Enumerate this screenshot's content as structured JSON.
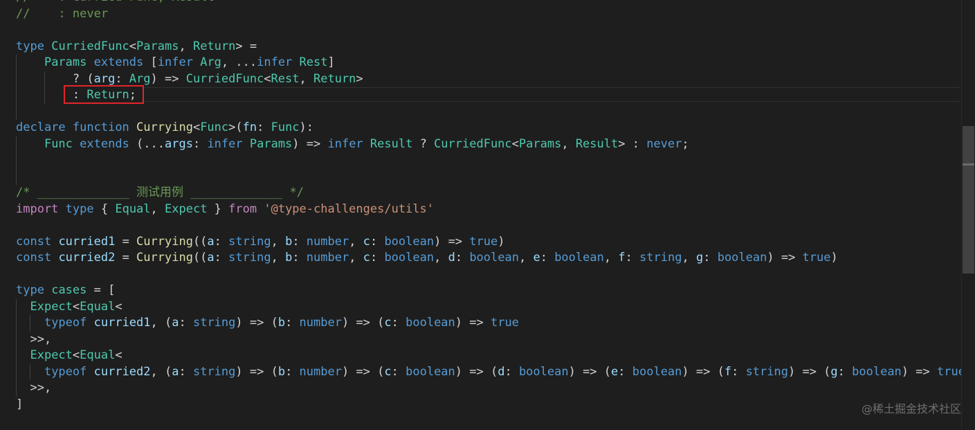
{
  "lines": [
    [
      {
        "t": "//    : Curried<Func, Result>",
        "c": "comment"
      }
    ],
    [
      {
        "t": "//    : never",
        "c": "comment"
      }
    ],
    [],
    [
      {
        "t": "type",
        "c": "keyword"
      },
      {
        "t": " ",
        "c": "plain"
      },
      {
        "t": "CurriedFunc",
        "c": "type"
      },
      {
        "t": "<",
        "c": "punct"
      },
      {
        "t": "Params",
        "c": "type"
      },
      {
        "t": ", ",
        "c": "punct"
      },
      {
        "t": "Return",
        "c": "type"
      },
      {
        "t": "> =",
        "c": "punct"
      }
    ],
    [
      {
        "t": "    ",
        "c": "plain"
      },
      {
        "t": "Params",
        "c": "type"
      },
      {
        "t": " ",
        "c": "plain"
      },
      {
        "t": "extends",
        "c": "keyword"
      },
      {
        "t": " [",
        "c": "punct"
      },
      {
        "t": "infer",
        "c": "keyword"
      },
      {
        "t": " ",
        "c": "plain"
      },
      {
        "t": "Arg",
        "c": "type"
      },
      {
        "t": ", ...",
        "c": "punct"
      },
      {
        "t": "infer",
        "c": "keyword"
      },
      {
        "t": " ",
        "c": "plain"
      },
      {
        "t": "Rest",
        "c": "type"
      },
      {
        "t": "]",
        "c": "punct"
      }
    ],
    [
      {
        "t": "        ? (",
        "c": "punct"
      },
      {
        "t": "arg",
        "c": "var"
      },
      {
        "t": ": ",
        "c": "punct"
      },
      {
        "t": "Arg",
        "c": "type"
      },
      {
        "t": ") => ",
        "c": "punct"
      },
      {
        "t": "CurriedFunc",
        "c": "type"
      },
      {
        "t": "<",
        "c": "punct"
      },
      {
        "t": "Rest",
        "c": "type"
      },
      {
        "t": ", ",
        "c": "punct"
      },
      {
        "t": "Return",
        "c": "type"
      },
      {
        "t": ">",
        "c": "punct"
      }
    ],
    [
      {
        "t": "        : ",
        "c": "punct"
      },
      {
        "t": "Return",
        "c": "type"
      },
      {
        "t": ";",
        "c": "punct"
      }
    ],
    [],
    [
      {
        "t": "declare",
        "c": "keyword"
      },
      {
        "t": " ",
        "c": "plain"
      },
      {
        "t": "function",
        "c": "keyword"
      },
      {
        "t": " ",
        "c": "plain"
      },
      {
        "t": "Currying",
        "c": "func"
      },
      {
        "t": "<",
        "c": "punct"
      },
      {
        "t": "Func",
        "c": "type"
      },
      {
        "t": ">(",
        "c": "punct"
      },
      {
        "t": "fn",
        "c": "var"
      },
      {
        "t": ": ",
        "c": "punct"
      },
      {
        "t": "Func",
        "c": "type"
      },
      {
        "t": "):",
        "c": "punct"
      }
    ],
    [
      {
        "t": "    ",
        "c": "plain"
      },
      {
        "t": "Func",
        "c": "type"
      },
      {
        "t": " ",
        "c": "plain"
      },
      {
        "t": "extends",
        "c": "keyword"
      },
      {
        "t": " (...",
        "c": "punct"
      },
      {
        "t": "args",
        "c": "var"
      },
      {
        "t": ": ",
        "c": "punct"
      },
      {
        "t": "infer",
        "c": "keyword"
      },
      {
        "t": " ",
        "c": "plain"
      },
      {
        "t": "Params",
        "c": "type"
      },
      {
        "t": ") => ",
        "c": "punct"
      },
      {
        "t": "infer",
        "c": "keyword"
      },
      {
        "t": " ",
        "c": "plain"
      },
      {
        "t": "Result",
        "c": "type"
      },
      {
        "t": " ? ",
        "c": "punct"
      },
      {
        "t": "CurriedFunc",
        "c": "type"
      },
      {
        "t": "<",
        "c": "punct"
      },
      {
        "t": "Params",
        "c": "type"
      },
      {
        "t": ", ",
        "c": "punct"
      },
      {
        "t": "Result",
        "c": "type"
      },
      {
        "t": "> : ",
        "c": "punct"
      },
      {
        "t": "never",
        "c": "keyword"
      },
      {
        "t": ";",
        "c": "punct"
      }
    ],
    [],
    [],
    [
      {
        "t": "/* _____________ 测试用例 _____________ */",
        "c": "comment"
      }
    ],
    [
      {
        "t": "import",
        "c": "control"
      },
      {
        "t": " ",
        "c": "plain"
      },
      {
        "t": "type",
        "c": "keyword"
      },
      {
        "t": " { ",
        "c": "punct"
      },
      {
        "t": "Equal",
        "c": "type"
      },
      {
        "t": ", ",
        "c": "punct"
      },
      {
        "t": "Expect",
        "c": "type"
      },
      {
        "t": " } ",
        "c": "punct"
      },
      {
        "t": "from",
        "c": "control"
      },
      {
        "t": " ",
        "c": "plain"
      },
      {
        "t": "'@type-challenges/utils'",
        "c": "string"
      }
    ],
    [],
    [
      {
        "t": "const",
        "c": "keyword"
      },
      {
        "t": " ",
        "c": "plain"
      },
      {
        "t": "curried1",
        "c": "var"
      },
      {
        "t": " = ",
        "c": "punct"
      },
      {
        "t": "Currying",
        "c": "func"
      },
      {
        "t": "((",
        "c": "punct"
      },
      {
        "t": "a",
        "c": "var"
      },
      {
        "t": ": ",
        "c": "punct"
      },
      {
        "t": "string",
        "c": "keyword"
      },
      {
        "t": ", ",
        "c": "punct"
      },
      {
        "t": "b",
        "c": "var"
      },
      {
        "t": ": ",
        "c": "punct"
      },
      {
        "t": "number",
        "c": "keyword"
      },
      {
        "t": ", ",
        "c": "punct"
      },
      {
        "t": "c",
        "c": "var"
      },
      {
        "t": ": ",
        "c": "punct"
      },
      {
        "t": "boolean",
        "c": "keyword"
      },
      {
        "t": ") => ",
        "c": "punct"
      },
      {
        "t": "true",
        "c": "keyword"
      },
      {
        "t": ")",
        "c": "punct"
      }
    ],
    [
      {
        "t": "const",
        "c": "keyword"
      },
      {
        "t": " ",
        "c": "plain"
      },
      {
        "t": "curried2",
        "c": "var"
      },
      {
        "t": " = ",
        "c": "punct"
      },
      {
        "t": "Currying",
        "c": "func"
      },
      {
        "t": "((",
        "c": "punct"
      },
      {
        "t": "a",
        "c": "var"
      },
      {
        "t": ": ",
        "c": "punct"
      },
      {
        "t": "string",
        "c": "keyword"
      },
      {
        "t": ", ",
        "c": "punct"
      },
      {
        "t": "b",
        "c": "var"
      },
      {
        "t": ": ",
        "c": "punct"
      },
      {
        "t": "number",
        "c": "keyword"
      },
      {
        "t": ", ",
        "c": "punct"
      },
      {
        "t": "c",
        "c": "var"
      },
      {
        "t": ": ",
        "c": "punct"
      },
      {
        "t": "boolean",
        "c": "keyword"
      },
      {
        "t": ", ",
        "c": "punct"
      },
      {
        "t": "d",
        "c": "var"
      },
      {
        "t": ": ",
        "c": "punct"
      },
      {
        "t": "boolean",
        "c": "keyword"
      },
      {
        "t": ", ",
        "c": "punct"
      },
      {
        "t": "e",
        "c": "var"
      },
      {
        "t": ": ",
        "c": "punct"
      },
      {
        "t": "boolean",
        "c": "keyword"
      },
      {
        "t": ", ",
        "c": "punct"
      },
      {
        "t": "f",
        "c": "var"
      },
      {
        "t": ": ",
        "c": "punct"
      },
      {
        "t": "string",
        "c": "keyword"
      },
      {
        "t": ", ",
        "c": "punct"
      },
      {
        "t": "g",
        "c": "var"
      },
      {
        "t": ": ",
        "c": "punct"
      },
      {
        "t": "boolean",
        "c": "keyword"
      },
      {
        "t": ") => ",
        "c": "punct"
      },
      {
        "t": "true",
        "c": "keyword"
      },
      {
        "t": ")",
        "c": "punct"
      }
    ],
    [],
    [
      {
        "t": "type",
        "c": "keyword"
      },
      {
        "t": " ",
        "c": "plain"
      },
      {
        "t": "cases",
        "c": "type"
      },
      {
        "t": " = [",
        "c": "punct"
      }
    ],
    [
      {
        "t": "  ",
        "c": "plain"
      },
      {
        "t": "Expect",
        "c": "type"
      },
      {
        "t": "<",
        "c": "punct"
      },
      {
        "t": "Equal",
        "c": "type"
      },
      {
        "t": "<",
        "c": "punct"
      }
    ],
    [
      {
        "t": "    ",
        "c": "plain"
      },
      {
        "t": "typeof",
        "c": "keyword"
      },
      {
        "t": " ",
        "c": "plain"
      },
      {
        "t": "curried1",
        "c": "var"
      },
      {
        "t": ", (",
        "c": "punct"
      },
      {
        "t": "a",
        "c": "var"
      },
      {
        "t": ": ",
        "c": "punct"
      },
      {
        "t": "string",
        "c": "keyword"
      },
      {
        "t": ") => (",
        "c": "punct"
      },
      {
        "t": "b",
        "c": "var"
      },
      {
        "t": ": ",
        "c": "punct"
      },
      {
        "t": "number",
        "c": "keyword"
      },
      {
        "t": ") => (",
        "c": "punct"
      },
      {
        "t": "c",
        "c": "var"
      },
      {
        "t": ": ",
        "c": "punct"
      },
      {
        "t": "boolean",
        "c": "keyword"
      },
      {
        "t": ") => ",
        "c": "punct"
      },
      {
        "t": "true",
        "c": "keyword"
      }
    ],
    [
      {
        "t": "  >>,",
        "c": "punct"
      }
    ],
    [
      {
        "t": "  ",
        "c": "plain"
      },
      {
        "t": "Expect",
        "c": "type"
      },
      {
        "t": "<",
        "c": "punct"
      },
      {
        "t": "Equal",
        "c": "type"
      },
      {
        "t": "<",
        "c": "punct"
      }
    ],
    [
      {
        "t": "    ",
        "c": "plain"
      },
      {
        "t": "typeof",
        "c": "keyword"
      },
      {
        "t": " ",
        "c": "plain"
      },
      {
        "t": "curried2",
        "c": "var"
      },
      {
        "t": ", (",
        "c": "punct"
      },
      {
        "t": "a",
        "c": "var"
      },
      {
        "t": ": ",
        "c": "punct"
      },
      {
        "t": "string",
        "c": "keyword"
      },
      {
        "t": ") => (",
        "c": "punct"
      },
      {
        "t": "b",
        "c": "var"
      },
      {
        "t": ": ",
        "c": "punct"
      },
      {
        "t": "number",
        "c": "keyword"
      },
      {
        "t": ") => (",
        "c": "punct"
      },
      {
        "t": "c",
        "c": "var"
      },
      {
        "t": ": ",
        "c": "punct"
      },
      {
        "t": "boolean",
        "c": "keyword"
      },
      {
        "t": ") => (",
        "c": "punct"
      },
      {
        "t": "d",
        "c": "var"
      },
      {
        "t": ": ",
        "c": "punct"
      },
      {
        "t": "boolean",
        "c": "keyword"
      },
      {
        "t": ") => (",
        "c": "punct"
      },
      {
        "t": "e",
        "c": "var"
      },
      {
        "t": ": ",
        "c": "punct"
      },
      {
        "t": "boolean",
        "c": "keyword"
      },
      {
        "t": ") => (",
        "c": "punct"
      },
      {
        "t": "f",
        "c": "var"
      },
      {
        "t": ": ",
        "c": "punct"
      },
      {
        "t": "string",
        "c": "keyword"
      },
      {
        "t": ") => (",
        "c": "punct"
      },
      {
        "t": "g",
        "c": "var"
      },
      {
        "t": ": ",
        "c": "punct"
      },
      {
        "t": "boolean",
        "c": "keyword"
      },
      {
        "t": ") => ",
        "c": "punct"
      },
      {
        "t": "true",
        "c": "keyword"
      }
    ],
    [
      {
        "t": "  >>,",
        "c": "punct"
      }
    ],
    [
      {
        "t": "]",
        "c": "punct"
      }
    ]
  ],
  "watermark": "@稀土掘金技术社区",
  "colors": {
    "background": "#1e1e1e",
    "comment": "#6a9955",
    "keyword": "#569cd6",
    "control": "#c586c0",
    "type": "#4ec9b0",
    "function": "#dcdcaa",
    "variable": "#9cdcfe",
    "string": "#ce9178",
    "punctuation": "#d4d4d4",
    "highlight_box": "#e0262b"
  }
}
